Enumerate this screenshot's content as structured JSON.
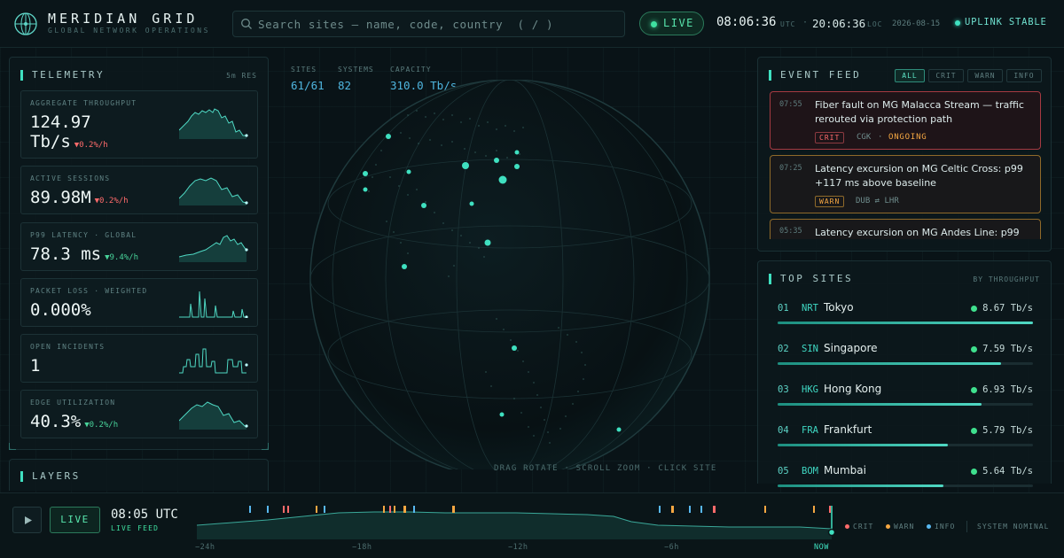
{
  "header": {
    "brand": "MERIDIAN GRID",
    "subtitle": "GLOBAL NETWORK OPERATIONS",
    "search_placeholder": "Search sites — name, code, country  ( / )",
    "live_label": "LIVE",
    "utc_time": "08:06:36",
    "utc_label": "UTC",
    "local_time": "20:06:36",
    "local_label": "LOC",
    "date": "2026-08-15",
    "uplink_status": "UPLINK STABLE"
  },
  "telemetry": {
    "title": "TELEMETRY",
    "resolution": "5m RES",
    "cards": [
      {
        "label": "AGGREGATE THROUGHPUT",
        "value": "124.97",
        "unit": "Tb/s",
        "delta": "▼0.2%/h",
        "trend": "down"
      },
      {
        "label": "ACTIVE SESSIONS",
        "value": "89.98M",
        "delta": "▼0.2%/h",
        "trend": "down"
      },
      {
        "label": "P99 LATENCY · GLOBAL",
        "value": "78.3 ms",
        "delta": "▼9.4%/h",
        "trend": "up"
      },
      {
        "label": "PACKET LOSS · WEIGHTED",
        "value": "0.000%",
        "delta": "",
        "trend": "none"
      },
      {
        "label": "OPEN INCIDENTS",
        "value": "1",
        "delta": "",
        "trend": "none"
      },
      {
        "label": "EDGE UTILIZATION",
        "value": "40.3%",
        "delta": "▼0.2%/h",
        "trend": "up"
      }
    ]
  },
  "layers": {
    "title": "LAYERS"
  },
  "globe": {
    "stats": [
      {
        "label": "SITES",
        "value": "61/61"
      },
      {
        "label": "SYSTEMS",
        "value": "82"
      },
      {
        "label": "CAPACITY",
        "value": "310.0 Tb/s"
      }
    ],
    "hint": "DRAG ROTATE · SCROLL ZOOM · CLICK SITE"
  },
  "event_feed": {
    "title": "EVENT FEED",
    "filters": [
      "ALL",
      "CRIT",
      "WARN",
      "INFO"
    ],
    "active_filter": "ALL",
    "events": [
      {
        "time": "07:55",
        "text": "Fiber fault on MG Malacca Stream — traffic rerouted via protection path",
        "severity": "CRIT",
        "route": "CGK",
        "status": "ONGOING"
      },
      {
        "time": "07:25",
        "text": "Latency excursion on MG Celtic Cross: p99 +117 ms above baseline",
        "severity": "WARN",
        "route": "DUB ⇄ LHR",
        "status": ""
      },
      {
        "time": "05:35",
        "text": "Latency excursion on MG Andes Line: p99",
        "severity": "WARN",
        "route": "",
        "status": ""
      }
    ]
  },
  "top_sites": {
    "title": "TOP SITES",
    "sort": "BY THROUGHPUT",
    "sites": [
      {
        "rank": "01",
        "code": "NRT",
        "name": "Tokyo",
        "value": "8.67 Tb/s",
        "share": 1.0
      },
      {
        "rank": "02",
        "code": "SIN",
        "name": "Singapore",
        "value": "7.59 Tb/s",
        "share": 0.875
      },
      {
        "rank": "03",
        "code": "HKG",
        "name": "Hong Kong",
        "value": "6.93 Tb/s",
        "share": 0.8
      },
      {
        "rank": "04",
        "code": "FRA",
        "name": "Frankfurt",
        "value": "5.79 Tb/s",
        "share": 0.668
      },
      {
        "rank": "05",
        "code": "BOM",
        "name": "Mumbai",
        "value": "5.64 Tb/s",
        "share": 0.651
      }
    ]
  },
  "timeline": {
    "live_label": "LIVE",
    "time": "08:05 UTC",
    "feed_label": "LIVE FEED",
    "ticks": [
      "−24h",
      "−18h",
      "−12h",
      "−6h",
      "NOW"
    ],
    "legend": [
      {
        "label": "CRIT",
        "color": "#ff6b6b"
      },
      {
        "label": "WARN",
        "color": "#f5a742"
      },
      {
        "label": "INFO",
        "color": "#58b8f0"
      }
    ],
    "system_status": "SYSTEM NOMINAL"
  },
  "colors": {
    "accent": "#3fe0c0",
    "crit": "#ff6b6b",
    "warn": "#f5a742",
    "info": "#58b8f0",
    "ok": "#3fe08e"
  }
}
